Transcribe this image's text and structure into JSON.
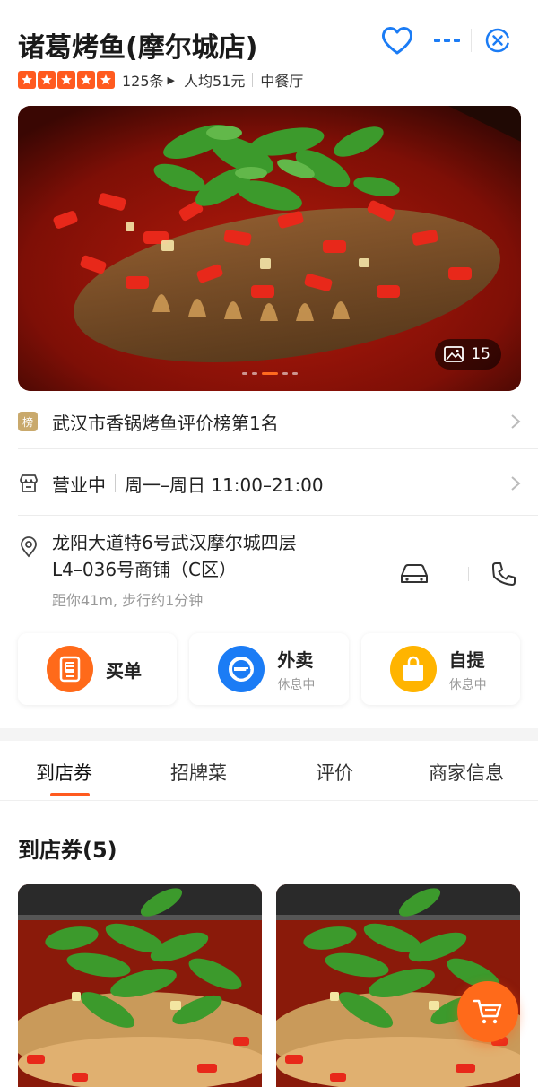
{
  "header": {
    "shop_name": "诸葛烤鱼(摩尔城店)",
    "rating_stars": 5,
    "review_count": "125条",
    "avg_price": "人均51元",
    "category": "中餐厅"
  },
  "hero": {
    "photo_count": "15",
    "carousel_dots": 5,
    "active_dot": 2
  },
  "ranking": {
    "badge": "榜",
    "text": "武汉市香锅烤鱼评价榜第1名"
  },
  "hours": {
    "status": "营业中",
    "schedule": "周一–周日 11:00–21:00"
  },
  "address": {
    "line1": "龙阳大道特6号武汉摩尔城四层",
    "line2": "L4–036号商铺（C区）",
    "distance": "距你41m, 步行约1分钟"
  },
  "services": [
    {
      "label": "买单",
      "sub": "",
      "color": "#ff6a1a",
      "icon": "bill-icon"
    },
    {
      "label": "外卖",
      "sub": "休息中",
      "color": "#1b7cf5",
      "icon": "delivery-icon"
    },
    {
      "label": "自提",
      "sub": "休息中",
      "color": "#ffb400",
      "icon": "pickup-bag-icon"
    }
  ],
  "tabs": [
    "到店券",
    "招牌菜",
    "评价",
    "商家信息"
  ],
  "active_tab": 0,
  "section": {
    "title": "到店券(5)"
  },
  "colors": {
    "accent": "#ff5a1f",
    "rank_badge": "#c9a96c",
    "cart": "#ff6a1a"
  }
}
